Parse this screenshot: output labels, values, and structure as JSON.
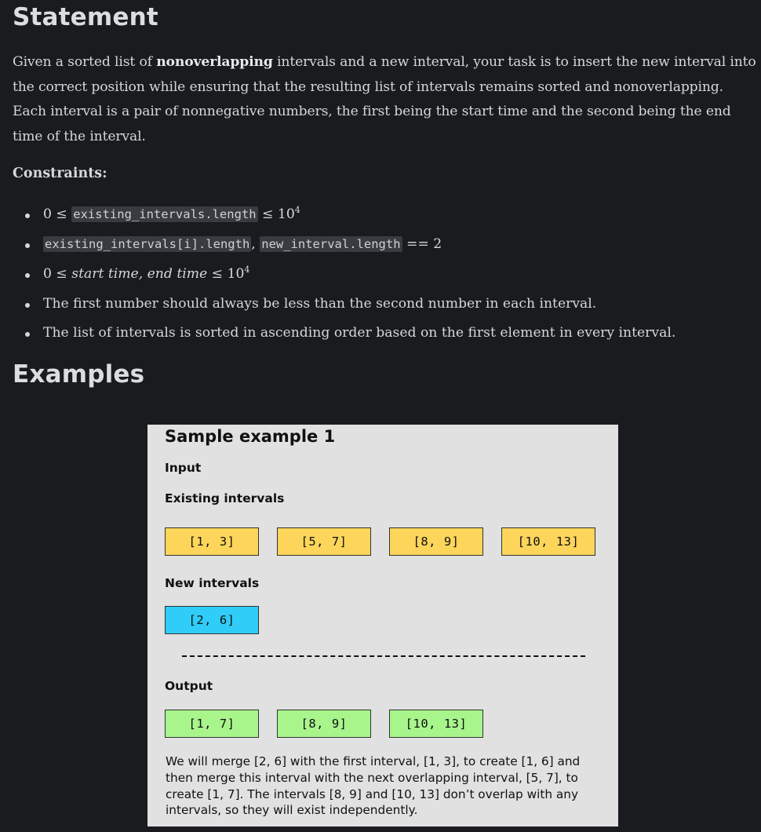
{
  "statement": {
    "heading": "Statement",
    "para_before_bold": "Given a sorted list of ",
    "para_bold": "nonoverlapping",
    "para_after_bold": " intervals and a new interval, your task is to insert the new interval into the correct position while ensuring that the resulting list of intervals remains sorted and nonoverlapping. Each interval is a pair of nonnegative numbers, the first being the start time and the second being the end time of the interval."
  },
  "constraints": {
    "label": "Constraints:",
    "c1": {
      "left": "0 ≤ ",
      "code": "existing_intervals.length",
      "right": " ≤ 10",
      "exp": "4"
    },
    "c2": {
      "code1": "existing_intervals[i].length",
      "sep": ", ",
      "code2": "new_interval.length",
      "right": " == 2"
    },
    "c3": {
      "left": "0 ≤ ",
      "var": "start time, end time",
      "right": " ≤ 10",
      "exp": "4"
    },
    "c4": "The first number should always be less than the second number in each interval.",
    "c5": "The list of intervals is sorted in ascending order based on the first element in every interval."
  },
  "examples": {
    "heading": "Examples",
    "sample": {
      "title": "Sample example 1",
      "input_label": "Input",
      "existing_label": "Existing intervals",
      "existing": [
        "[1, 3]",
        "[5, 7]",
        "[8, 9]",
        "[10, 13]"
      ],
      "new_label": "New intervals",
      "new": [
        "[2, 6]"
      ],
      "output_label": "Output",
      "output": [
        "[1, 7]",
        "[8, 9]",
        "[10, 13]"
      ],
      "explanation": "We will merge [2, 6] with the first interval, [1, 3], to create [1, 6] and then merge this interval with the next overlapping interval, [5, 7], to create [1, 7]. The intervals [8, 9] and [10, 13] don’t overlap with any intervals, so they will exist independently.",
      "colors": {
        "existing": "#fcd55a",
        "new": "#2fcdf8",
        "output": "#a8f58c",
        "panel": "#e1e1e1"
      }
    }
  }
}
